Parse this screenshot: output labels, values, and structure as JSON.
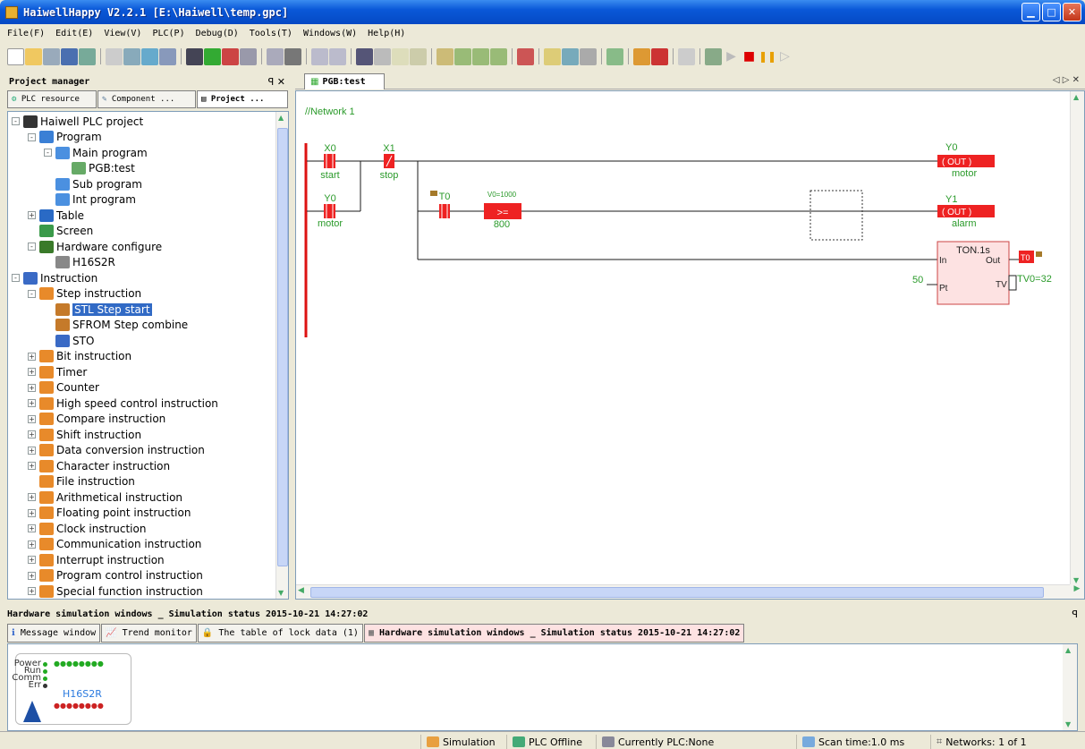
{
  "window": {
    "title": "HaiwellHappy V2.2.1 [E:\\Haiwell\\temp.gpc]"
  },
  "menu": [
    "File(F)",
    "Edit(E)",
    "View(V)",
    "PLC(P)",
    "Debug(D)",
    "Tools(T)",
    "Windows(W)",
    "Help(H)"
  ],
  "project_manager": {
    "title": "Project manager",
    "pin": "p ×",
    "tabs": [
      "PLC resource",
      "Component ...",
      "Project ..."
    ],
    "tree": [
      {
        "label": "Haiwell PLC project",
        "level": 0,
        "exp": "-",
        "icon": "project"
      },
      {
        "label": "Program",
        "level": 1,
        "exp": "-",
        "icon": "program"
      },
      {
        "label": "Main program",
        "level": 2,
        "exp": "-",
        "icon": "folder"
      },
      {
        "label": "PGB:test",
        "level": 3,
        "exp": "",
        "icon": "ladder"
      },
      {
        "label": "Sub program",
        "level": 2,
        "exp": "",
        "icon": "folder"
      },
      {
        "label": "Int program",
        "level": 2,
        "exp": "",
        "icon": "folder"
      },
      {
        "label": "Table",
        "level": 1,
        "exp": "+",
        "icon": "table"
      },
      {
        "label": "Screen",
        "level": 1,
        "exp": "",
        "icon": "screen"
      },
      {
        "label": "Hardware configure",
        "level": 1,
        "exp": "-",
        "icon": "hardware"
      },
      {
        "label": "H16S2R",
        "level": 2,
        "exp": "",
        "icon": "device"
      },
      {
        "label": "Instruction",
        "level": 0,
        "exp": "-",
        "icon": "instruction"
      },
      {
        "label": "Step instruction",
        "level": 1,
        "exp": "-",
        "icon": "category"
      },
      {
        "label": "STL Step start",
        "level": 2,
        "exp": "",
        "icon": "step",
        "selected": true
      },
      {
        "label": "SFROM Step combine",
        "level": 2,
        "exp": "",
        "icon": "step"
      },
      {
        "label": "STO",
        "level": 2,
        "exp": "",
        "icon": "sto"
      },
      {
        "label": "Bit instruction",
        "level": 1,
        "exp": "+",
        "icon": "category"
      },
      {
        "label": "Timer",
        "level": 1,
        "exp": "+",
        "icon": "timer"
      },
      {
        "label": "Counter",
        "level": 1,
        "exp": "+",
        "icon": "category"
      },
      {
        "label": "High speed control instruction",
        "level": 1,
        "exp": "+",
        "icon": "category"
      },
      {
        "label": "Compare instruction",
        "level": 1,
        "exp": "+",
        "icon": "category"
      },
      {
        "label": "Shift instruction",
        "level": 1,
        "exp": "+",
        "icon": "category"
      },
      {
        "label": "Data conversion instruction",
        "level": 1,
        "exp": "+",
        "icon": "category"
      },
      {
        "label": "Character instruction",
        "level": 1,
        "exp": "+",
        "icon": "category"
      },
      {
        "label": "File instruction",
        "level": 1,
        "exp": "",
        "icon": "category"
      },
      {
        "label": "Arithmetical instruction",
        "level": 1,
        "exp": "+",
        "icon": "category"
      },
      {
        "label": "Floating point instruction",
        "level": 1,
        "exp": "+",
        "icon": "category"
      },
      {
        "label": "Clock instruction",
        "level": 1,
        "exp": "+",
        "icon": "timer"
      },
      {
        "label": "Communication instruction",
        "level": 1,
        "exp": "+",
        "icon": "category"
      },
      {
        "label": "Interrupt instruction",
        "level": 1,
        "exp": "+",
        "icon": "category"
      },
      {
        "label": "Program control instruction",
        "level": 1,
        "exp": "+",
        "icon": "category"
      },
      {
        "label": "Special function instruction",
        "level": 1,
        "exp": "+",
        "icon": "category"
      }
    ]
  },
  "editor": {
    "tab": "PGB:test",
    "network": "//Network 1",
    "contacts": {
      "x0": {
        "addr": "X0",
        "label": "start"
      },
      "x1": {
        "addr": "X1",
        "label": "stop"
      },
      "y0_contact": {
        "addr": "Y0",
        "label": "motor"
      },
      "t0_contact": {
        "addr": "T0"
      },
      "cmp": {
        "top": "V0=1000",
        "op": ">=",
        "val": "800"
      }
    },
    "coils": {
      "y0": {
        "addr": "Y0",
        "text": "( OUT )",
        "label": "motor"
      },
      "y1": {
        "addr": "Y1",
        "text": "( OUT )",
        "label": "alarm"
      }
    },
    "timer": {
      "name": "TON.1s",
      "in": "In",
      "out": "Out",
      "pt": "Pt",
      "tv": "TV",
      "pt_value": "50",
      "out_var": "T0",
      "tv_value": "TV0=32"
    }
  },
  "simulation": {
    "header": "Hardware simulation windows _ Simulation status 2015-10-21 14:27:02",
    "pin": "p",
    "tabs": [
      "Message window",
      "Trend monitor",
      "The table of lock  data (1)",
      "Hardware simulation windows _ Simulation status 2015-10-21 14:27:02"
    ],
    "device": {
      "name": "H16S2R",
      "labels": [
        "Power",
        "Run",
        "Comm",
        "Err"
      ]
    }
  },
  "status": {
    "simulation": "Simulation",
    "plc": "PLC Offline",
    "current": "Currently PLC:None",
    "scan": "Scan time:1.0 ms",
    "networks": "Networks:  1 of 1"
  },
  "colors": {
    "accent": "#316ac5",
    "contact_red": "#ee2222",
    "rung_green": "#2a9a2a",
    "rail_red": "#dd1111"
  }
}
